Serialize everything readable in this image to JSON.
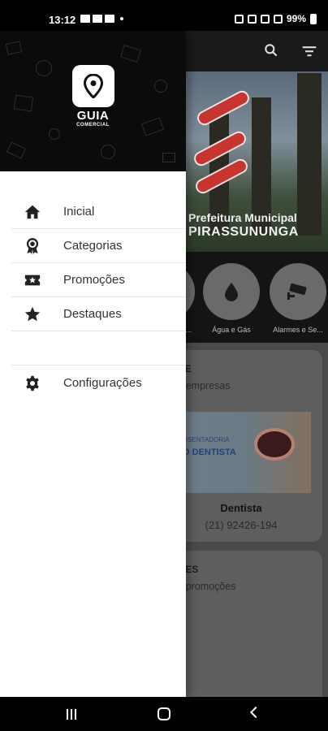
{
  "status_bar": {
    "time": "13:12",
    "battery": "99%"
  },
  "header": {
    "search_icon": "search-icon",
    "filter_icon": "filter-icon"
  },
  "banner": {
    "line1": "Prefeitura Municipal",
    "line2": "PIRASSUNUNGA"
  },
  "categories": [
    {
      "label": "...",
      "icon": "category-icon"
    },
    {
      "label": "Água e Gás",
      "icon": "water-drop-icon"
    },
    {
      "label": "Alarmes e Se...",
      "icon": "security-camera-icon"
    }
  ],
  "cards": {
    "featured": {
      "title": "UE",
      "subtitle": "s empresas",
      "ad_text_small": "OSENTADORIA",
      "ad_text_big": "O DENTISTA",
      "name": "Dentista",
      "phone": "(21) 92426-194"
    },
    "promotions": {
      "title": "ÕES",
      "subtitle": "s promoções"
    }
  },
  "drawer": {
    "logo_title": "GUIA",
    "logo_subtitle": "COMERCIAL",
    "menu": [
      {
        "label": "Inicial",
        "icon": "home-icon"
      },
      {
        "label": "Categorias",
        "icon": "badge-icon"
      },
      {
        "label": "Promoções",
        "icon": "ticket-icon"
      },
      {
        "label": "Destaques",
        "icon": "star-icon"
      }
    ],
    "settings": {
      "label": "Configurações",
      "icon": "gear-icon"
    }
  },
  "colors": {
    "drawer_bg": "#ffffff",
    "drawer_header_bg": "#0b0b0b",
    "menu_text": "#333333",
    "icon_color": "#222222"
  }
}
